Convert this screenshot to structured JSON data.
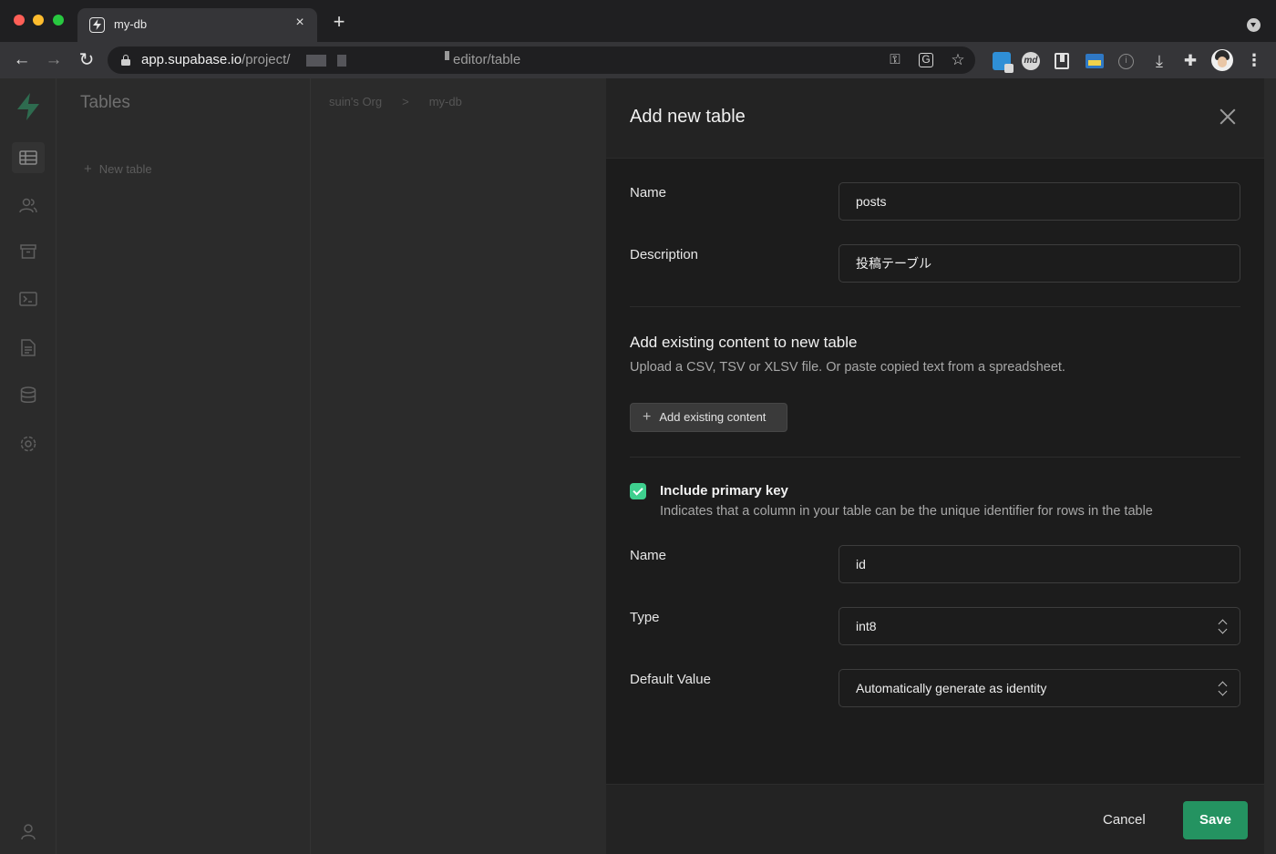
{
  "browser": {
    "tab_title": "my-db",
    "tab_close": "×",
    "new_tab": "+",
    "url_host": "app.supabase.io",
    "url_prefix": "/project/",
    "url_path": "editor/table",
    "nav_back": "←",
    "nav_forward": "→",
    "nav_reload": "↻",
    "key_icon": "⚿",
    "translate_icon": "G",
    "star_icon": "☆",
    "ext_md": "md",
    "ext_info": "i",
    "ext_download": "⤓",
    "ext_puzzle": "✚",
    "menu": "⋮"
  },
  "background": {
    "tables_title": "Tables",
    "new_table_plus": "+",
    "new_table": "New table",
    "breadcrumb_org": "suin's Org",
    "breadcrumb_sep": ">",
    "breadcrumb_project": "my-db",
    "rail_icons": [
      "table-icon",
      "users-icon",
      "archive-icon",
      "terminal-icon",
      "document-icon",
      "database-icon",
      "settings-icon",
      "account-icon"
    ]
  },
  "panel": {
    "title": "Add new table",
    "name_label": "Name",
    "name_value": "posts",
    "description_label": "Description",
    "description_value": "投稿テーブル",
    "existing_title": "Add existing content to new table",
    "existing_desc": "Upload a CSV, TSV or XLSV file. Or paste copied text from a spreadsheet.",
    "add_existing_plus": "+",
    "add_existing_label": "Add existing content",
    "include_pk_checked": true,
    "include_pk_title": "Include primary key",
    "include_pk_desc": "Indicates that a column in your table can be the unique identifier for rows in the table",
    "pk_name_label": "Name",
    "pk_name_value": "id",
    "type_label": "Type",
    "type_value": "int8",
    "default_label": "Default Value",
    "default_value": "Automatically generate as identity",
    "cancel_label": "Cancel",
    "save_label": "Save"
  },
  "colors": {
    "accent": "#3ecf8e",
    "save_button": "#249361",
    "panel_bg": "#1c1c1c"
  }
}
